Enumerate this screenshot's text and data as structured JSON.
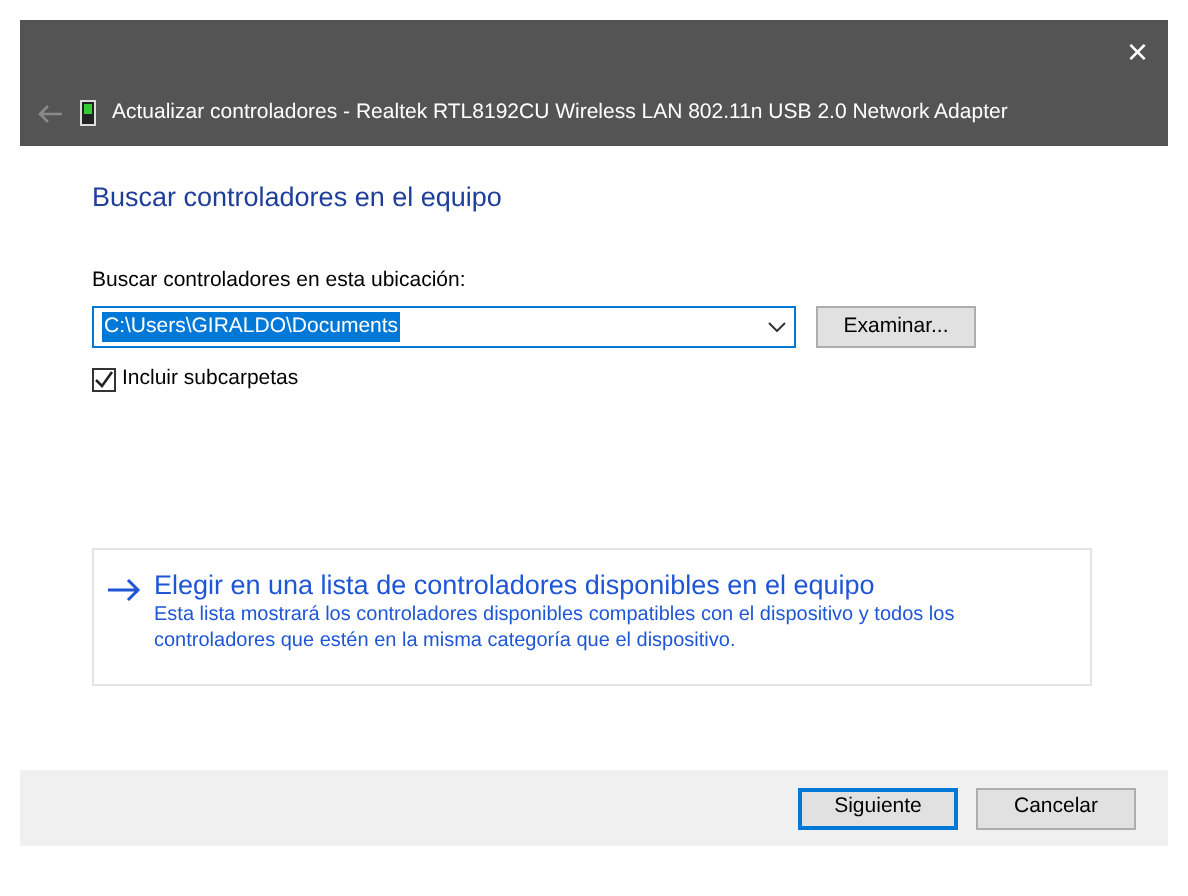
{
  "window": {
    "title": "Actualizar controladores - Realtek RTL8192CU Wireless LAN 802.11n USB 2.0 Network Adapter",
    "close": "×",
    "back_disabled": true
  },
  "heading": "Buscar controladores en el equipo",
  "location": {
    "label": "Buscar controladores en esta ubicación:",
    "value": "C:\\Users\\GIRALDO\\Documents",
    "browse_button": "Examinar..."
  },
  "include_subfolders": {
    "label": "Incluir subcarpetas",
    "checked": true
  },
  "command_link": {
    "title": "Elegir en una lista de controladores disponibles en el equipo",
    "description": "Esta lista mostrará los controladores disponibles compatibles con el dispositivo y todos los controladores que estén en la misma categoría que el dispositivo."
  },
  "buttons": [
    {
      "label": "Siguiente",
      "default": true
    },
    {
      "label": "Cancelar",
      "default": false
    }
  ]
}
